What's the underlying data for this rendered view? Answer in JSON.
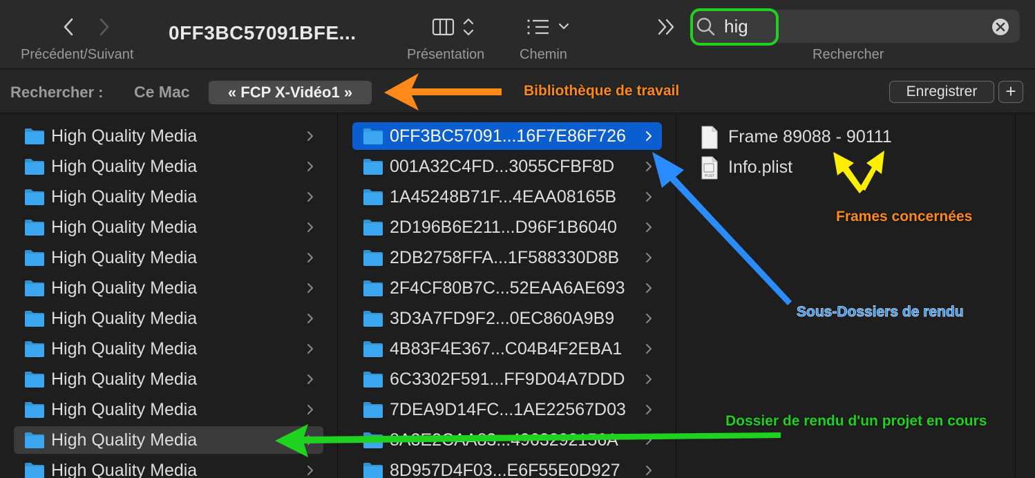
{
  "toolbar": {
    "nav_label": "Précédent/Suivant",
    "window_title": "0FF3BC57091BFE...",
    "view_label": "Présentation",
    "path_label": "Chemin",
    "search_label": "Rechercher",
    "search_value": "hig"
  },
  "scope": {
    "label": "Rechercher :",
    "this_mac": "Ce Mac",
    "library": "« FCP X-Vidéo1 »",
    "save_label": "Enregistrer",
    "add_label": "+"
  },
  "column1": {
    "items": [
      "High Quality Media",
      "High Quality Media",
      "High Quality Media",
      "High Quality Media",
      "High Quality Media",
      "High Quality Media",
      "High Quality Media",
      "High Quality Media",
      "High Quality Media",
      "High Quality Media",
      "High Quality Media",
      "High Quality Media"
    ],
    "selected_index": 10
  },
  "column2": {
    "items": [
      "0FF3BC57091...16F7E86F726",
      "001A32C4FD...3055CFBF8D",
      "1A45248B71F...4EAA08165B",
      "2D196B6E211...D96F1B6040",
      "2DB2758FFA...1F588330D8B",
      "2F4CF80B7C...52EAA6AE693",
      "3D3A7FD9F2...0EC860A9B9",
      "4B83F4E367...C04B4F2EBA1",
      "6C3302F591...FF9D04A7DDD",
      "7DEA9D14FC...1AE22567D03",
      "8A3E2CAA83...4963292156A",
      "8D957D4F03...E6F55E0D927"
    ],
    "selected_index": 0
  },
  "column3": {
    "items": [
      {
        "name": "Frame 89088 - 90111",
        "icon": "document-icon"
      },
      {
        "name": "Info.plist",
        "icon": "plist-icon",
        "badge": "PLIST"
      }
    ]
  },
  "annotations": {
    "library": "Bibliothèque de travail",
    "frames": "Frames concernées",
    "subfolders": "Sous-Dossiers de rendu",
    "render_folder": "Dossier de rendu d'un projet en cours"
  },
  "colors": {
    "folder": "#3aa7f0",
    "selection": "#0a5ed0",
    "highlight_green": "#1fd21f",
    "arrow_orange": "#ff8a1a",
    "arrow_blue": "#2a8cff",
    "arrow_yellow": "#ffee00"
  }
}
